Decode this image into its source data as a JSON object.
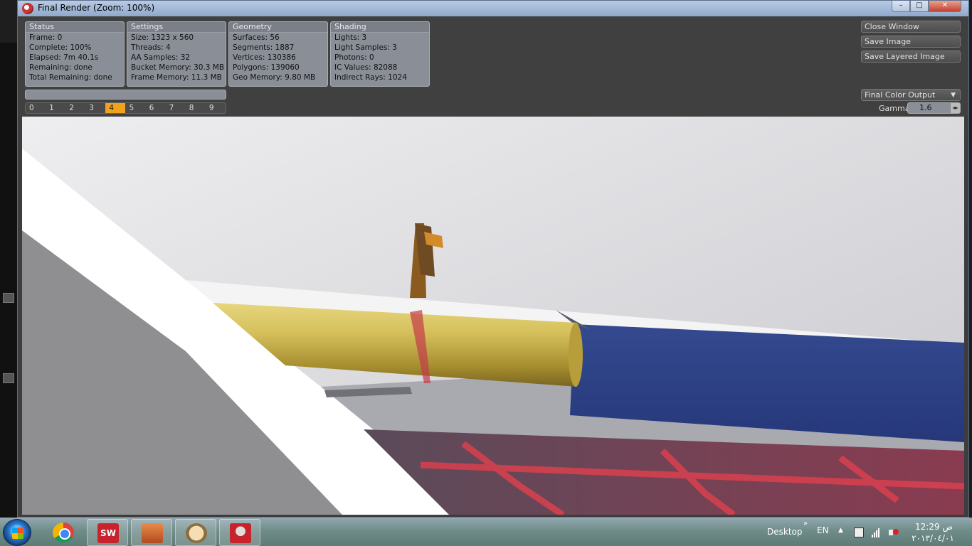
{
  "window": {
    "title": "Final Render (Zoom: 100%)",
    "minimize": "–",
    "maximize": "□",
    "close": "✕"
  },
  "panels": {
    "status": {
      "header": "Status",
      "rows": [
        "Frame: 0",
        "Complete: 100%",
        "Elapsed: 7m 40.1s",
        "Remaining: done",
        "Total Remaining: done"
      ]
    },
    "settings": {
      "header": "Settings",
      "rows": [
        "Size: 1323 x 560",
        "Threads: 4",
        "AA Samples: 32",
        "Bucket Memory: 30.3 MB",
        "Frame Memory: 11.3 MB"
      ]
    },
    "geometry": {
      "header": "Geometry",
      "rows": [
        "Surfaces: 56",
        "Segments: 1887",
        "Vertices: 130386",
        "Polygons: 139060",
        "Geo Memory: 9.80 MB"
      ]
    },
    "shading": {
      "header": "Shading",
      "rows": [
        "Lights: 3",
        "Light Samples: 3",
        "Photons: 0",
        "IC Values: 82088",
        "Indirect Rays: 1024"
      ]
    }
  },
  "render_progress": 1.0,
  "buffers": {
    "labels": [
      "0",
      "1",
      "2",
      "3",
      "4",
      "5",
      "6",
      "7",
      "8",
      "9"
    ],
    "active_index": 4,
    "active_color": "#f0a21c"
  },
  "actions": {
    "close_window": "Close Window",
    "save_image": "Save Image",
    "save_layered_image": "Save Layered Image"
  },
  "output": {
    "selected": "Final Color Output",
    "gamma_label": "Gamma",
    "gamma_value": "1.6"
  },
  "taskbar": {
    "items": [
      "start-button-icon",
      "chrome-icon",
      "solidworks-icon",
      "render-app-icon",
      "paint-icon",
      "solidworks-render-icon"
    ],
    "desktop_label": "Desktop",
    "language": "EN",
    "chevron": "»",
    "tray_up": "▲",
    "clock_time": "12:29 ص",
    "clock_date": "٢٠١٣/٠٤/٠١"
  },
  "colors": {
    "brass_tube": "#c9b04a",
    "blue_plate": "#2a3f86",
    "pcb_red": "#c33b4a",
    "accent_orange": "#f0a21c"
  }
}
